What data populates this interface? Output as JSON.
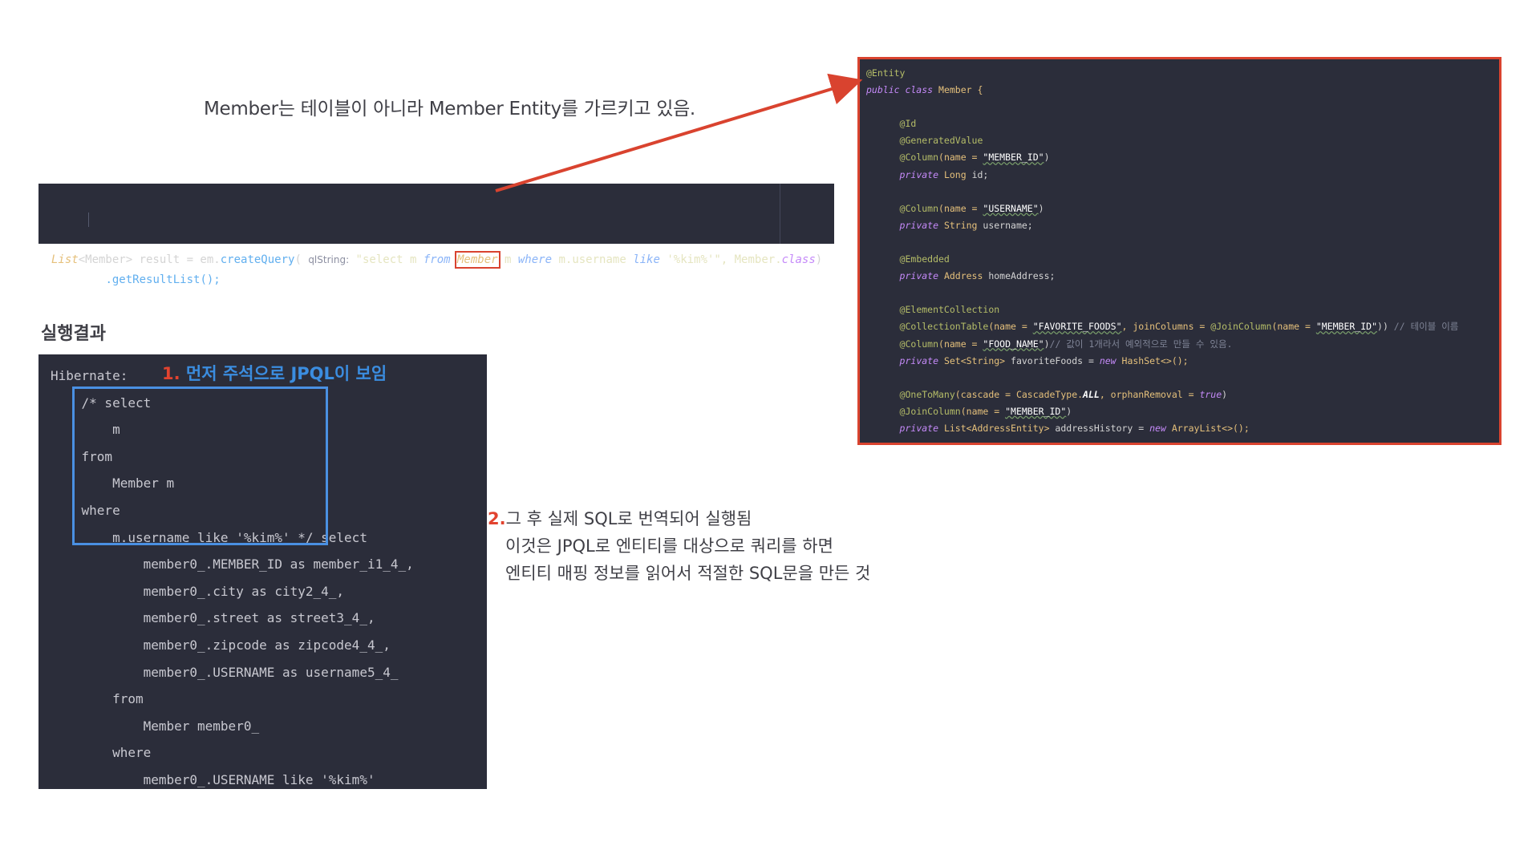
{
  "caption": "Member는 테이블이 아니라 Member Entity를 가르키고 있음.",
  "code_snippet": {
    "t1": "List",
    "t2": "<Member> result = em.",
    "t3": "createQuery",
    "t4": "( ",
    "hint": "qlString:",
    "t5": " \"select m ",
    "t6": "from",
    "member": "Member",
    "t7": " m ",
    "t8": "where",
    "t9": " m.username ",
    "t10": "like",
    "t11": " '%kim%'\", Member.",
    "t12": "class",
    "t13": ")",
    "line2": ".getResultList();"
  },
  "entity": {
    "l1": "@Entity",
    "l2a": "public class",
    "l2b": " Member {",
    "l3": "@Id",
    "l4": "@GeneratedValue",
    "l5a": "@Column",
    "l5b": "(name = ",
    "l5c": "\"MEMBER_ID\"",
    "l5d": ")",
    "l6a": "private",
    "l6b": " Long",
    "l6c": " id;",
    "l7a": "@Column",
    "l7b": "(name = ",
    "l7c": "\"USERNAME\"",
    "l7d": ")",
    "l8a": "private",
    "l8b": " String",
    "l8c": " username;",
    "l9": "@Embedded",
    "l10a": "private",
    "l10b": " Address",
    "l10c": " homeAddress;",
    "l11": "@ElementCollection",
    "l12a": "@CollectionTable",
    "l12b": "(name = ",
    "l12c": "\"FAVORITE_FOODS\"",
    "l12d": ", joinColumns = ",
    "l12e": "@JoinColumn",
    "l12f": "(name = ",
    "l12g": "\"MEMBER_ID\"",
    "l12h": ")) ",
    "l12i": "// 테이블 이름",
    "l13a": "@Column",
    "l13b": "(name = ",
    "l13c": "\"FOOD_NAME\"",
    "l13d": ")",
    "l13e": "// 값이 1개라서 예외적으로 만들 수 있음.",
    "l14a": "private",
    "l14b": " Set<String>",
    "l14c": " favoriteFoods = ",
    "l14d": "new",
    "l14e": " HashSet<>();",
    "l15a": "@OneToMany",
    "l15b": "(cascade = CascadeType.",
    "l15c": "ALL",
    "l15d": ", orphanRemoval = ",
    "l15e": "true",
    "l15f": ")",
    "l16a": "@JoinColumn",
    "l16b": "(name = ",
    "l16c": "\"MEMBER_ID\"",
    "l16d": ")",
    "l17a": "private",
    "l17b": " List<AddressEntity>",
    "l17c": " addressHistory = ",
    "l17d": "new",
    "l17e": " ArrayList<>();"
  },
  "result_title": "실행결과",
  "console": {
    "lines": [
      "Hibernate:",
      "    /* select",
      "        m",
      "    from",
      "        Member m",
      "    where",
      "        m.username like '%kim%' */ select",
      "            member0_.MEMBER_ID as member_i1_4_,",
      "            member0_.city as city2_4_,",
      "            member0_.street as street3_4_,",
      "            member0_.zipcode as zipcode4_4_,",
      "            member0_.USERNAME as username5_4_",
      "        from",
      "            Member member0_",
      "        where",
      "            member0_.USERNAME like '%kim%'"
    ]
  },
  "note1": {
    "num": "1.",
    "text": " 먼저 주석으로  JPQL이 보임"
  },
  "note2": {
    "num": "2.",
    "line1": "그 후 실제 SQL로 번역되어 실행됨",
    "line2": "이것은 JPQL로 엔티티를 대상으로 쿼리를 하면",
    "line3": "엔티티 매핑 정보를 읽어서 적절한 SQL문을 만든 것"
  },
  "colors": {
    "red": "#d9432f",
    "blue": "#4a90e2",
    "panel": "#2b2d3a"
  }
}
